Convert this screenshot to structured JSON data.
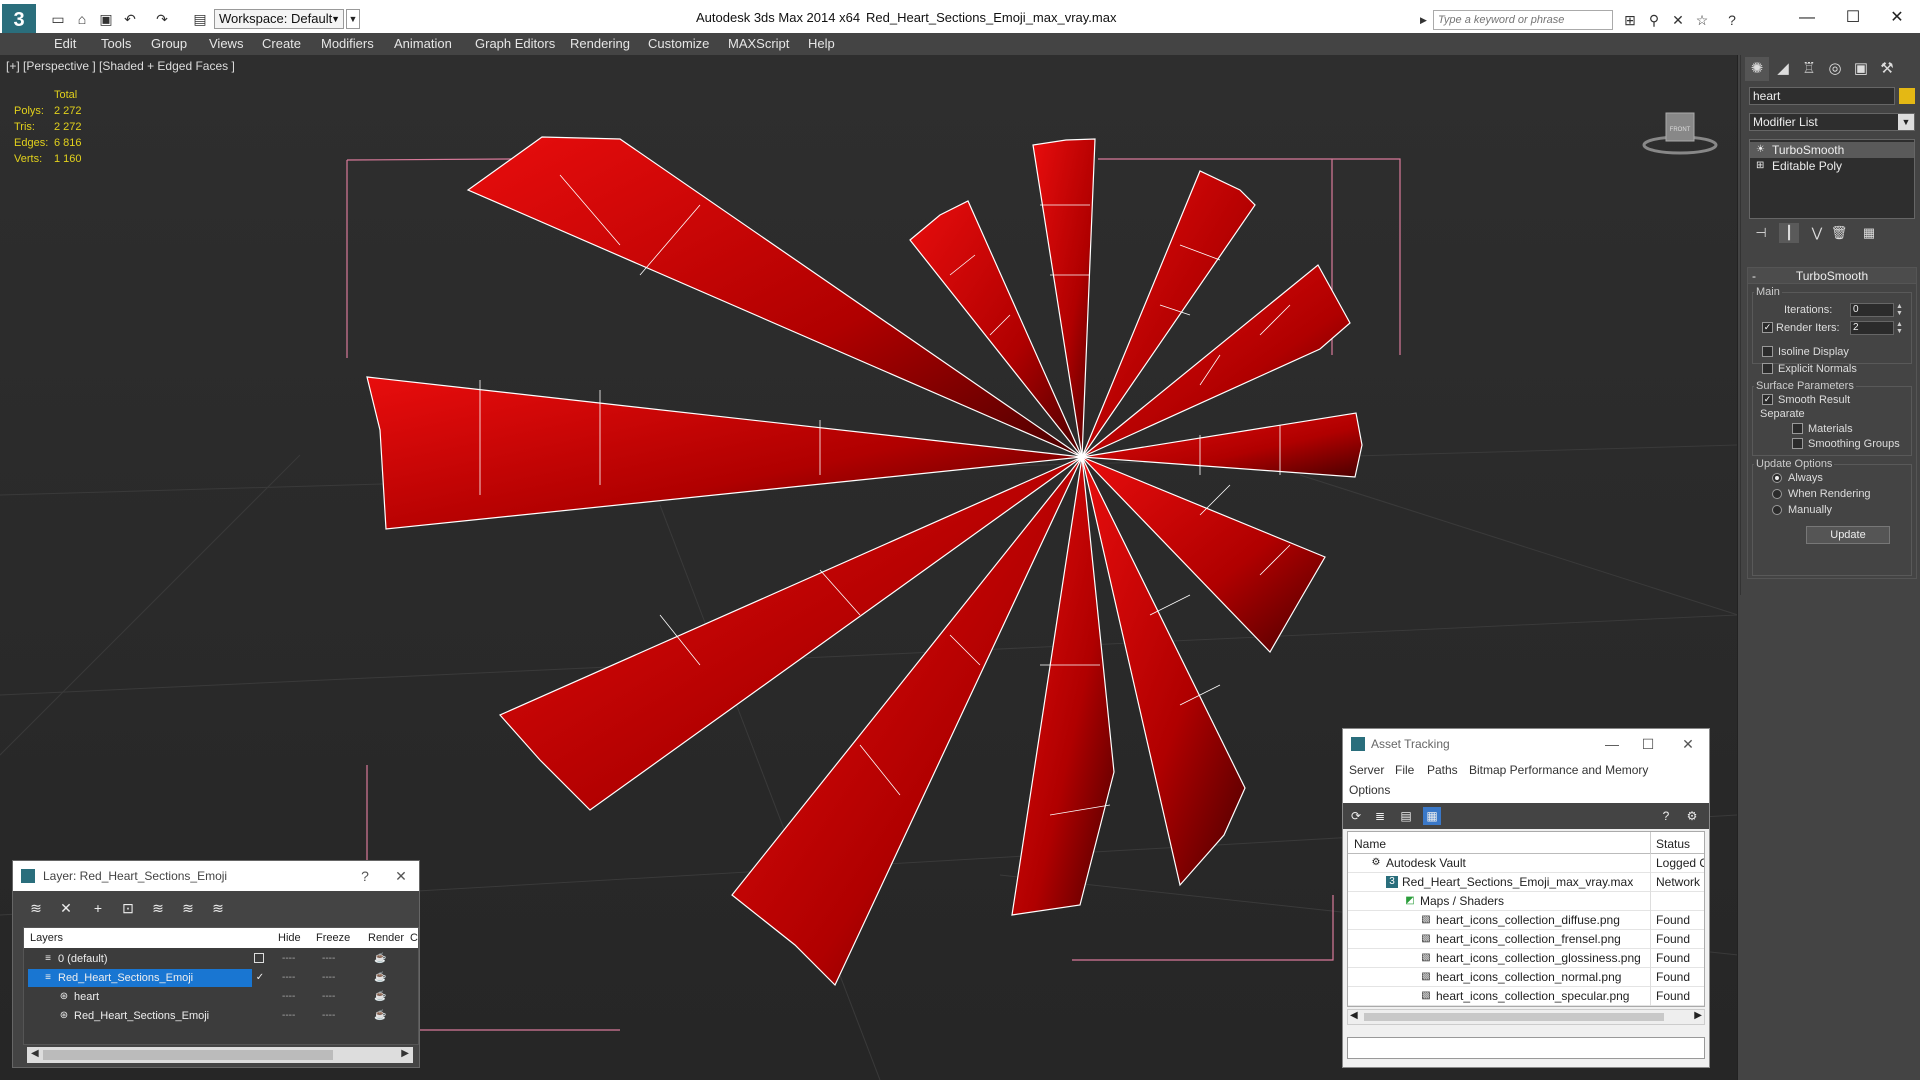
{
  "titlebar": {
    "app_title": "Autodesk 3ds Max  2014 x64",
    "file_title": "Red_Heart_Sections_Emoji_max_vray.max",
    "workspace": "Workspace: Default",
    "search_placeholder": "Type a keyword or phrase",
    "logo": "3"
  },
  "menu": [
    "Edit",
    "Tools",
    "Group",
    "Views",
    "Create",
    "Modifiers",
    "Animation",
    "Graph Editors",
    "Rendering",
    "Customize",
    "MAXScript",
    "Help"
  ],
  "viewport": {
    "label": "[+] [Perspective ] [Shaded + Edged Faces ]",
    "stats": {
      "header": "Total",
      "rows": [
        {
          "label": "Polys:",
          "value": "2 272"
        },
        {
          "label": "Tris:",
          "value": "2 272"
        },
        {
          "label": "Edges:",
          "value": "6 816"
        },
        {
          "label": "Verts:",
          "value": "1 160"
        }
      ]
    },
    "viewcube_label": "FRONT"
  },
  "command_panel": {
    "object_name": "heart",
    "object_color": "#e4b814",
    "modifier_list": "Modifier List",
    "stack": [
      "TurboSmooth",
      "Editable Poly"
    ],
    "rollout_title": "TurboSmooth",
    "main_group": "Main",
    "iterations_label": "Iterations:",
    "iterations_value": "0",
    "render_iters_label": "Render Iters:",
    "render_iters_value": "2",
    "isoline": "Isoline Display",
    "explicit": "Explicit Normals",
    "surface_group": "Surface Parameters",
    "smooth_result": "Smooth Result",
    "separate": "Separate",
    "materials": "Materials",
    "smoothing_groups": "Smoothing Groups",
    "update_group": "Update Options",
    "always": "Always",
    "when_rendering": "When Rendering",
    "manually": "Manually",
    "update_button": "Update"
  },
  "asset_tracking": {
    "title": "Asset Tracking",
    "menu": [
      "Server",
      "File",
      "Paths",
      "Bitmap Performance and Memory",
      "Options"
    ],
    "col_name": "Name",
    "col_status": "Status",
    "rows": [
      {
        "name": "Autodesk Vault",
        "status": "Logged Out"
      },
      {
        "name": "Red_Heart_Sections_Emoji_max_vray.max",
        "status": "Network"
      },
      {
        "name": "Maps / Shaders",
        "status": ""
      },
      {
        "name": "heart_icons_collection_diffuse.png",
        "status": "Found"
      },
      {
        "name": "heart_icons_collection_frensel.png",
        "status": "Found"
      },
      {
        "name": "heart_icons_collection_glossiness.png",
        "status": "Found"
      },
      {
        "name": "heart_icons_collection_normal.png",
        "status": "Found"
      },
      {
        "name": "heart_icons_collection_specular.png",
        "status": "Found"
      }
    ]
  },
  "layer_dialog": {
    "title": "Layer: Red_Heart_Sections_Emoji",
    "help": "?",
    "col_layers": "Layers",
    "col_hide": "Hide",
    "col_freeze": "Freeze",
    "col_render": "Render",
    "col_extra": "C",
    "rows": [
      {
        "name": "0 (default)"
      },
      {
        "name": "Red_Heart_Sections_Emoji"
      },
      {
        "name": "heart"
      },
      {
        "name": "Red_Heart_Sections_Emoji"
      }
    ],
    "dash": "----"
  },
  "colors": {
    "accent": "#1976d2",
    "petal": "#d10000",
    "stats": "#e2d11c"
  }
}
